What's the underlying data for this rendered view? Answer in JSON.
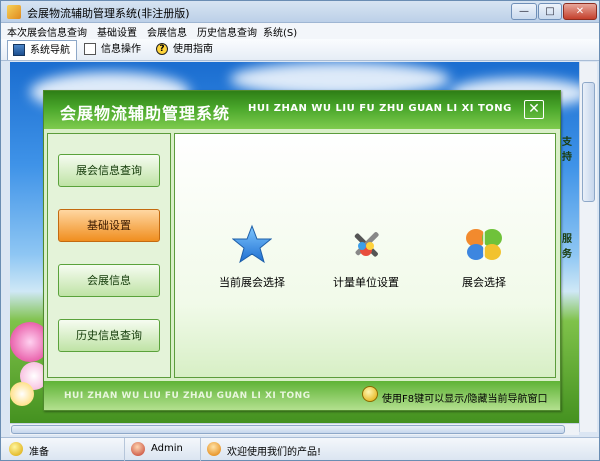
{
  "window": {
    "title": "会展物流辅助管理系统(非注册版)",
    "controls": {
      "minimize": "—",
      "maximize": "□",
      "close": "✕"
    }
  },
  "menu": [
    {
      "label": "本次展会信息查询"
    },
    {
      "label": "基础设置"
    },
    {
      "label": "会展信息"
    },
    {
      "label": "历史信息查询"
    },
    {
      "label": "系统(S)"
    }
  ],
  "toolbar": {
    "tabs": [
      {
        "label": "系统导航",
        "icon": "navigation-icon",
        "active": true
      },
      {
        "label": "信息操作",
        "icon": "document-icon",
        "active": false
      },
      {
        "label": "使用指南",
        "icon": "help-icon",
        "active": false
      }
    ],
    "help_glyph": "?"
  },
  "background": {
    "side_text_1": "支持",
    "side_text_2": "服务"
  },
  "panel": {
    "title": "会展物流辅助管理系统",
    "title_en": "HUI ZHAN WU LIU FU ZHU GUAN LI XI TONG",
    "close_glyph": "✕",
    "nav": [
      {
        "label": "展会信息查询",
        "active": false
      },
      {
        "label": "基础设置",
        "active": true
      },
      {
        "label": "会展信息",
        "active": false
      },
      {
        "label": "历史信息查询",
        "active": false
      }
    ],
    "tiles": [
      {
        "label": "当前展会选择",
        "icon": "star-icon"
      },
      {
        "label": "计量单位设置",
        "icon": "tools-icon"
      },
      {
        "label": "展会选择",
        "icon": "butterfly-icon"
      }
    ],
    "footer_en": "HUI ZHAN WU LIU FU ZHAU  GUAN LI XI TONG",
    "footer_hint": "使用F8键可以显示/隐藏当前导航窗口"
  },
  "status": {
    "state": "准备",
    "user": "Admin",
    "message": "欢迎使用我们的产品!"
  },
  "colors": {
    "panel_head": "#3c961f",
    "active_button": "#f08e1f",
    "nav_button": "#bfe3a5"
  }
}
